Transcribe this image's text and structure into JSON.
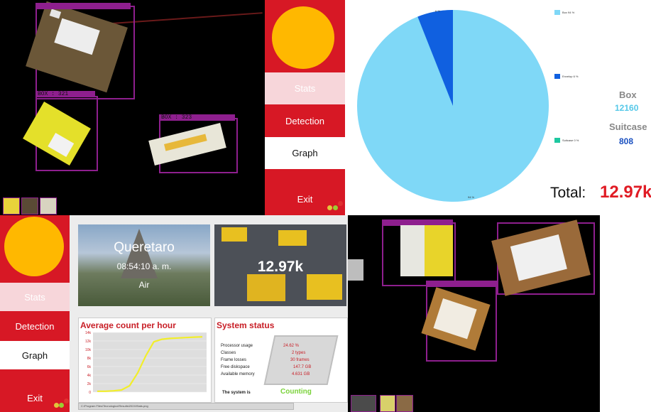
{
  "nav_top": {
    "stats": "Stats",
    "detection": "Detection",
    "graph": "Graph",
    "exit": "Exit"
  },
  "nav_bottom": {
    "stats": "Stats",
    "detection": "Detection",
    "graph": "Graph",
    "exit": "Exit"
  },
  "pie": {
    "label_box": "Box 94 %",
    "label_envelope": "Envelop 6 %",
    "label_suitcase": "Suitcase 0 %",
    "slice_top_label": "6 %",
    "slice_bottom_label": "94 %",
    "colors": {
      "box": "#7fd8f7",
      "envelope": "#1060e0",
      "suitcase": "#1ec8a0"
    }
  },
  "chart_data": [
    {
      "type": "pie",
      "categories": [
        "Box",
        "Envelop",
        "Suitcase"
      ],
      "values": [
        94,
        6,
        0
      ]
    },
    {
      "type": "line",
      "title": "Average count per hour",
      "ylim": [
        0,
        14
      ],
      "y_ticks": [
        "0",
        "2k",
        "4k",
        "6k",
        "8k",
        "10k",
        "12k",
        "14k"
      ],
      "series": [
        {
          "values": [
            0.2,
            0.2,
            0.3,
            0.5,
            1.5,
            4.5,
            8.5,
            11.8,
            12.4,
            12.6,
            12.7,
            12.8,
            12.9,
            12.97
          ]
        }
      ]
    }
  ],
  "totals": {
    "box_label": "Box",
    "box_value": "12160",
    "suitcase_label": "Suitcase",
    "suitcase_value": "808",
    "total_label": "Total:",
    "total_value": "12.97k"
  },
  "location": {
    "city": "Queretaro",
    "time": "08:54:10 a. m.",
    "weather": "Air"
  },
  "count_tile": {
    "value": "12.97k"
  },
  "system": {
    "title": "System status",
    "rows": [
      {
        "label": "Processor usage",
        "value": "24.62 %"
      },
      {
        "label": "Classes",
        "value": "2 types"
      },
      {
        "label": "Frame losses",
        "value": "30 frames"
      },
      {
        "label": "Free diskspace",
        "value": "147.7 GB"
      },
      {
        "label": "Available memory",
        "value": "4.631 GB"
      }
    ],
    "status_label": "The system is",
    "status_value": "Counting"
  },
  "detections": {
    "label_1": "BOX  :  321",
    "label_2": "BOX  :  323"
  },
  "footer": {
    "path": "C:\\Program Files\\Tecnologico\\Results\\2024\\Stats.png"
  }
}
